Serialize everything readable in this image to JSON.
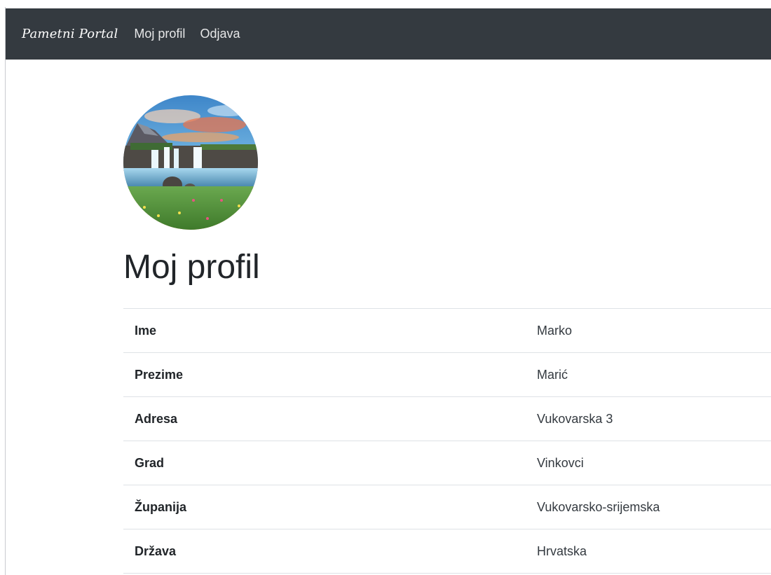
{
  "navbar": {
    "brand": "Pametni Portal",
    "links": [
      "Moj profil",
      "Odjava"
    ]
  },
  "page_title": "Moj profil",
  "profile": [
    {
      "label": "Ime",
      "value": "Marko"
    },
    {
      "label": "Prezime",
      "value": "Marić"
    },
    {
      "label": "Adresa",
      "value": "Vukovarska 3"
    },
    {
      "label": "Grad",
      "value": "Vinkovci"
    },
    {
      "label": "Županija",
      "value": "Vukovarsko-srijemska"
    },
    {
      "label": "Država",
      "value": "Hrvatska"
    }
  ],
  "colors": {
    "navbar_bg": "#343a40",
    "table_border": "#dee2e6"
  }
}
